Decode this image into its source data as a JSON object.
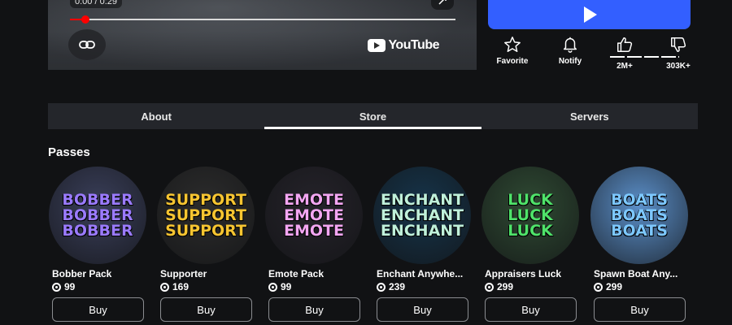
{
  "video": {
    "time": "0:00 / 0:29",
    "progress_fraction": 0.04,
    "provider": "YouTube"
  },
  "actions": {
    "favorite_label": "Favorite",
    "notify_label": "Notify",
    "upvotes": "2M+",
    "downvotes": "303K+",
    "upvote_fraction": 0.85
  },
  "tabs": [
    {
      "label": "About",
      "active": false
    },
    {
      "label": "Store",
      "active": true
    },
    {
      "label": "Servers",
      "active": false
    }
  ],
  "passes": {
    "title": "Passes",
    "buy_label": "Buy",
    "items": [
      {
        "name": "Bobber Pack",
        "price": "99",
        "art_text": [
          "BOBBER",
          "BOBBER",
          "BOBBER"
        ],
        "art_color": "#9b7bff",
        "bg": "#3a3f5a"
      },
      {
        "name": "Supporter",
        "price": "169",
        "art_text": [
          "SUPPORT",
          "SUPPORT",
          "SUPPORT"
        ],
        "art_color": "#f7c531",
        "bg": "#2c2c2c"
      },
      {
        "name": "Emote Pack",
        "price": "99",
        "art_text": [
          "EMOTE",
          "EMOTE",
          "EMOTE"
        ],
        "art_color": "#f3a6f2",
        "bg": "#25232a"
      },
      {
        "name": "Enchant Anywhe...",
        "price": "239",
        "art_text": [
          "ENCHANT",
          "ENCHANT",
          "ENCHANT"
        ],
        "art_color": "#bff0da",
        "bg": "#16344a"
      },
      {
        "name": "Appraisers Luck",
        "price": "299",
        "art_text": [
          "LUCK",
          "LUCK",
          "LUCK"
        ],
        "art_color": "#4fe36a",
        "bg": "#2f4a33"
      },
      {
        "name": "Spawn Boat Any...",
        "price": "299",
        "art_text": [
          "BOATS",
          "BOATS",
          "BOATS"
        ],
        "art_color": "#7dc8ff",
        "bg": "#5b8fc9"
      }
    ]
  }
}
